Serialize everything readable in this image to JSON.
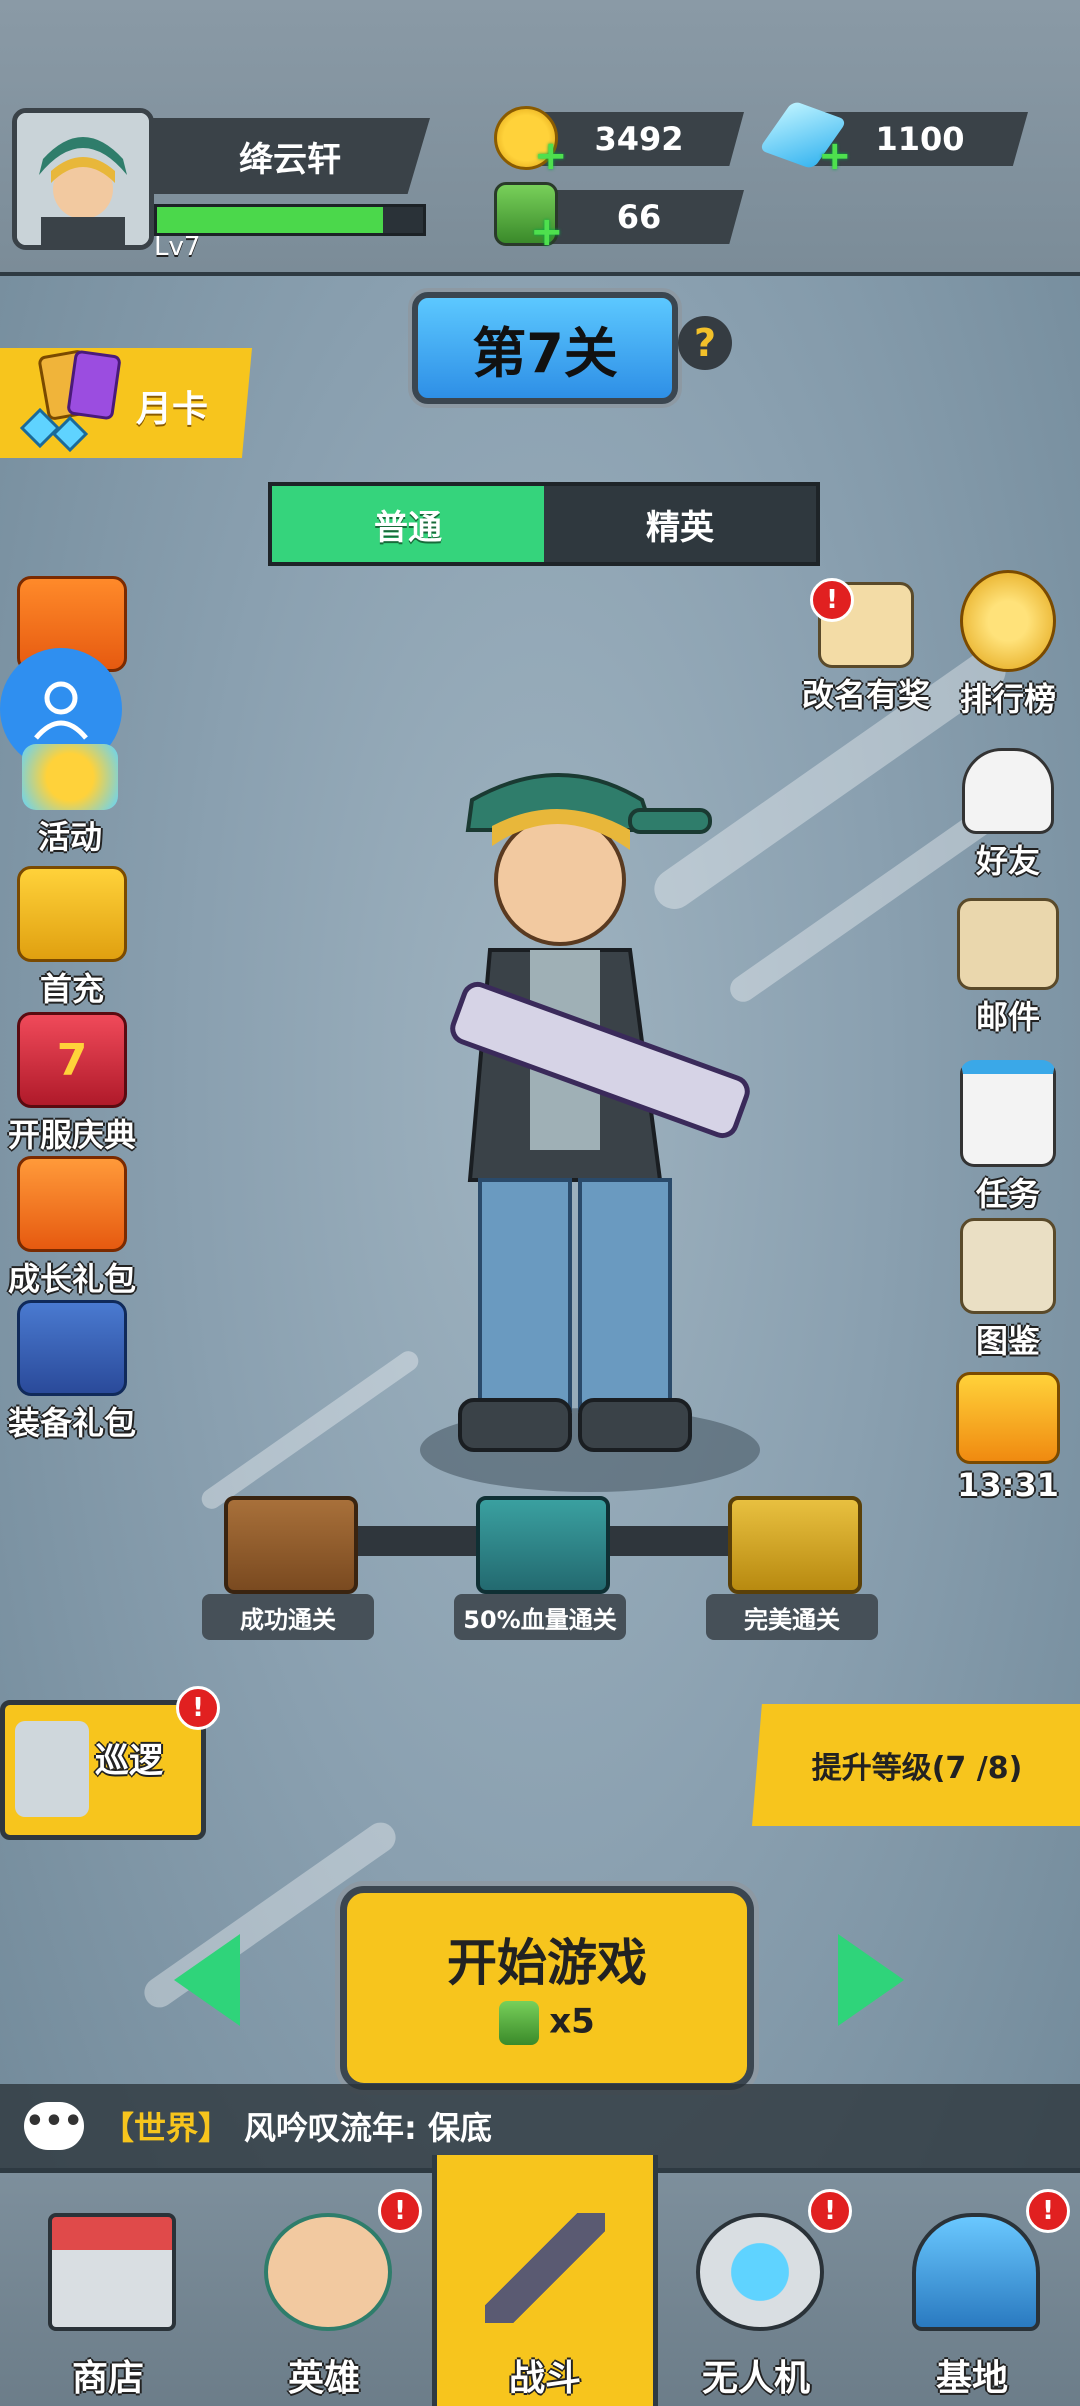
{
  "player": {
    "name": "绛云轩",
    "level": "Lv7",
    "xp_progress": 0.85
  },
  "resources": {
    "coins": "3492",
    "gems": "1100",
    "energy": "66"
  },
  "level_title": "第7关",
  "help_label": "?",
  "month_card": "月卡",
  "tabs": {
    "normal": "普通",
    "elite": "精英",
    "active": "普通"
  },
  "left_menu": [
    {
      "label": ""
    },
    {
      "label": "活动"
    },
    {
      "label": "首充"
    },
    {
      "label": "开服庆典",
      "icon_text": "7"
    },
    {
      "label": "成长礼包"
    },
    {
      "label": "装备礼包"
    }
  ],
  "right_menu": [
    {
      "label": "改名有奖",
      "badge": "!"
    },
    {
      "label": "排行榜"
    },
    {
      "label": "好友"
    },
    {
      "label": "邮件"
    },
    {
      "label": "任务"
    },
    {
      "label": "图鉴"
    },
    {
      "label": "13:31"
    }
  ],
  "rewards": [
    {
      "label": "成功通关"
    },
    {
      "label": "50%血量通关"
    },
    {
      "label": "完美通关"
    }
  ],
  "patrol": {
    "label": "巡逻",
    "badge": "!"
  },
  "upgrade_label": "提升等级(7 /8)",
  "start_button": {
    "label": "开始游戏",
    "cost": "x5"
  },
  "chat": {
    "channel": "【世界】",
    "message": "风吟叹流年: 保底"
  },
  "nav": [
    {
      "label": "商店",
      "badge": ""
    },
    {
      "label": "英雄",
      "badge": "!"
    },
    {
      "label": "战斗",
      "badge": ""
    },
    {
      "label": "无人机",
      "badge": "!"
    },
    {
      "label": "基地",
      "badge": "!"
    }
  ],
  "colors": {
    "accent_yellow": "#f7c51d",
    "accent_green": "#35d47c",
    "accent_blue": "#2e8fe6",
    "badge_red": "#e12020"
  }
}
